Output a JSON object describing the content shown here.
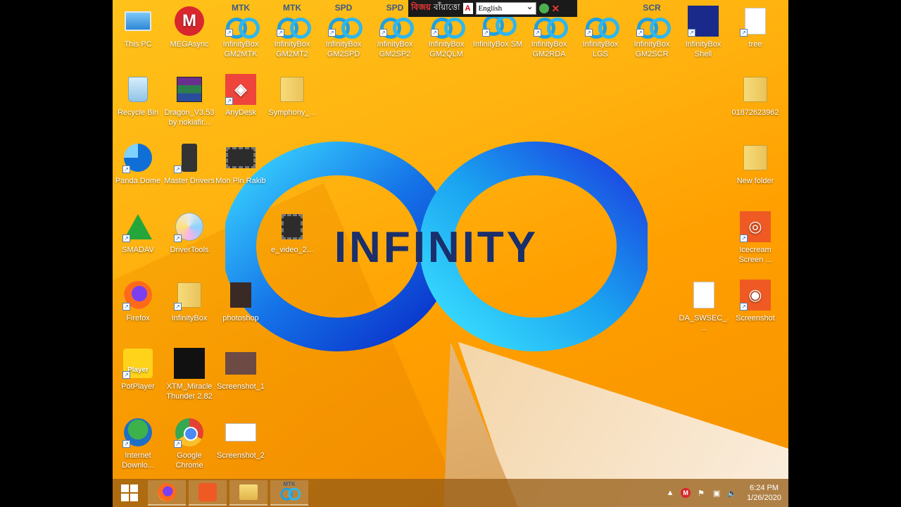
{
  "desktop": {
    "icons": [
      {
        "label": "This PC"
      },
      {
        "label": "MEGAsync"
      },
      {
        "label": "InfinityBox GM2MTK",
        "tag": "MTK"
      },
      {
        "label": "InfinityBox GM2MT2",
        "tag": "MTK"
      },
      {
        "label": "InfinityBox GM2SPD",
        "tag": "SPD"
      },
      {
        "label": "InfinityBox GM2SP2",
        "tag": "SPD"
      },
      {
        "label": "InfinityBox GM2QLM"
      },
      {
        "label": "InfinityBox SM"
      },
      {
        "label": "InfinityBox GM2RDA"
      },
      {
        "label": "InfinityBox LGS"
      },
      {
        "label": "InfinityBox GM2SCR",
        "tag": "SCR"
      },
      {
        "label": "InfinityBox Shell"
      },
      {
        "label": "tree"
      },
      {
        "label": "Recycle Bin"
      },
      {
        "label": "Dragon_V3.53 by nokiafir..."
      },
      {
        "label": "AnyDesk"
      },
      {
        "label": "Symphony_..."
      },
      {
        "label": "01872623962"
      },
      {
        "label": "Panda Dome"
      },
      {
        "label": "Master Drivers"
      },
      {
        "label": "Mon Pin Rakib"
      },
      {
        "label": "New folder"
      },
      {
        "label": "SMADAV"
      },
      {
        "label": "DriverTools"
      },
      {
        "label": "e_video_2..."
      },
      {
        "label": "Icecream Screen ..."
      },
      {
        "label": "Firefox"
      },
      {
        "label": "InfinityBox"
      },
      {
        "label": "photoshop"
      },
      {
        "label": "DA_SWSEC_..."
      },
      {
        "label": "Screenshot"
      },
      {
        "label": "PotPlayer",
        "badge": "Player"
      },
      {
        "label": "XTM_Miracle Thunder 2.82"
      },
      {
        "label": "Screenshot_1"
      },
      {
        "label": "Internet Downlo..."
      },
      {
        "label": "Google Chrome"
      },
      {
        "label": "Screenshot_2"
      }
    ],
    "wallpaper_text": "INFINITY"
  },
  "language_bar": {
    "word1": "বিজয়",
    "word2": "বাঁয়াত্তো",
    "language": "English"
  },
  "taskbar": {
    "apps": [
      "firefox",
      "icecream-screen-recorder",
      "file-explorer",
      "infinitybox-mtk"
    ],
    "app_tag": "MTK",
    "time": "6:24 PM",
    "date": "1/26/2020",
    "colors": {
      "accent": "#1fa0e0",
      "taskbar": "#965c14"
    }
  }
}
